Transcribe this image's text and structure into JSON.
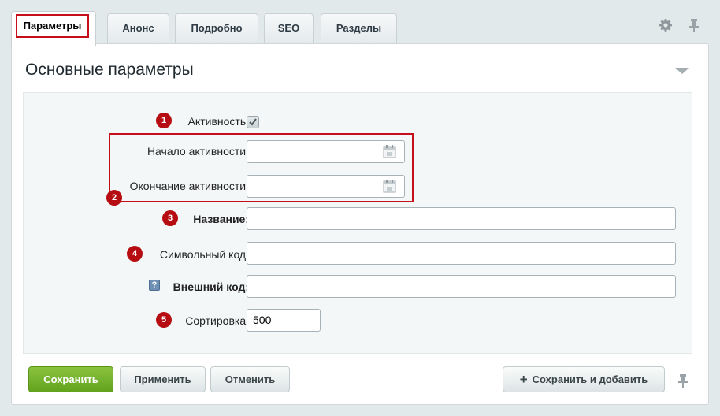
{
  "tabs": [
    {
      "label": "Параметры",
      "active": true
    },
    {
      "label": "Анонс"
    },
    {
      "label": "Подробно"
    },
    {
      "label": "SEO"
    },
    {
      "label": "Разделы"
    }
  ],
  "toolbar": {
    "settings_icon": "gear-icon",
    "pin_icon": "pin-icon"
  },
  "section": {
    "title": "Основные параметры"
  },
  "fields": {
    "active": {
      "label": "Активность:",
      "badge": "1",
      "checked": true
    },
    "start": {
      "label": "Начало активности:",
      "value": ""
    },
    "end": {
      "label": "Окончание активности:",
      "value": ""
    },
    "dates_badge": "2",
    "name": {
      "label": "Название:",
      "badge": "3",
      "value": ""
    },
    "code": {
      "label": "Символьный код:",
      "badge": "4",
      "value": ""
    },
    "external": {
      "label": "Внешний код:",
      "help": "?",
      "value": ""
    },
    "sort": {
      "label": "Сортировка:",
      "badge": "5",
      "value": "500"
    }
  },
  "buttons": {
    "save": "Сохранить",
    "apply": "Применить",
    "cancel": "Отменить",
    "save_add_plus": "+",
    "save_add": "Сохранить и добавить"
  },
  "colors": {
    "accent_red": "#c5101c",
    "save_green": "#6fae2a"
  }
}
